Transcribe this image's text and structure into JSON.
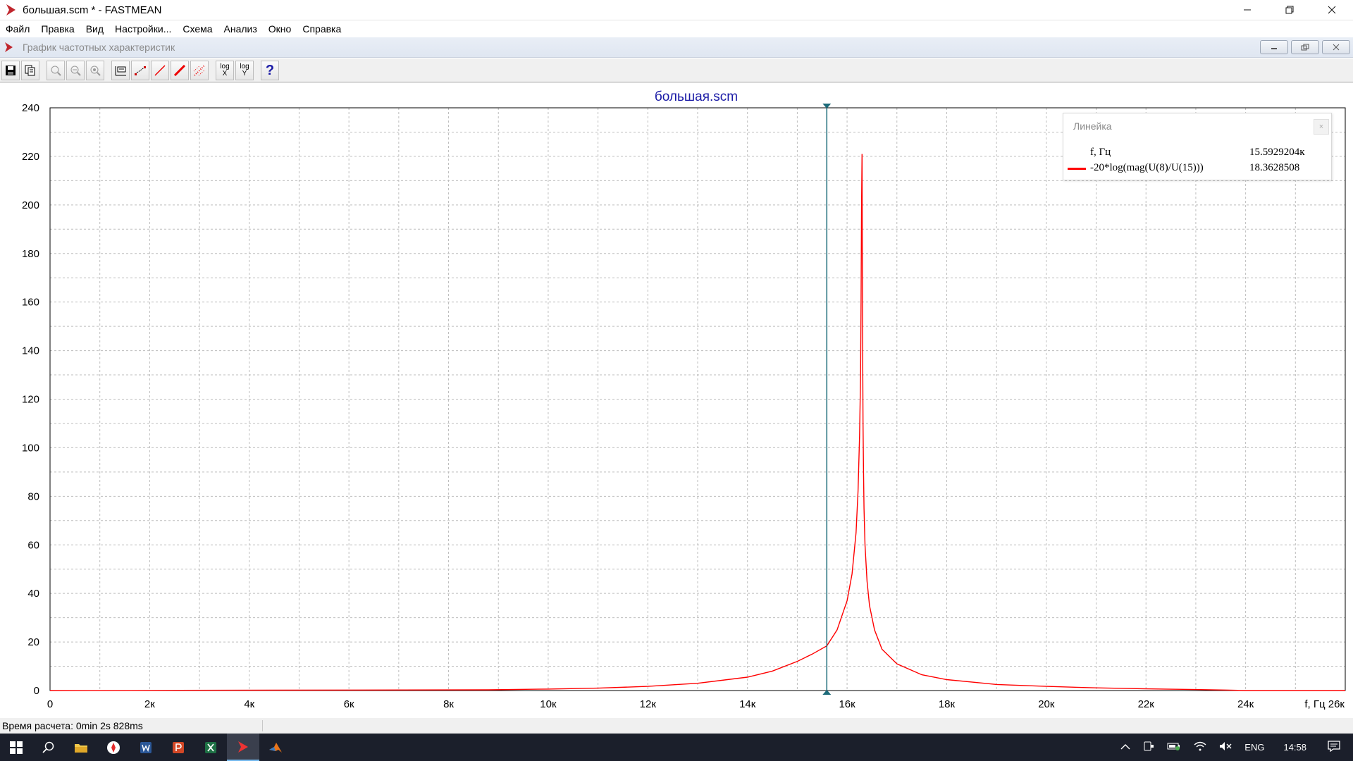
{
  "window": {
    "title": "большая.scm * - FASTMEAN",
    "minimize_icon": "minimize-icon",
    "restore_icon": "restore-icon",
    "close_icon": "close-icon"
  },
  "menu": [
    "Файл",
    "Правка",
    "Вид",
    "Настройки...",
    "Схема",
    "Анализ",
    "Окно",
    "Справка"
  ],
  "child_window": {
    "title": "График частотных характеристик"
  },
  "toolbar": {
    "log_x_top": "log",
    "log_x_bottom": "X",
    "log_y_top": "log",
    "log_y_bottom": "Y",
    "help": "?"
  },
  "ruler_panel": {
    "title": "Линейка",
    "close": "×",
    "rows": [
      {
        "label": "f, Гц",
        "value": "15.5929204к"
      },
      {
        "label": "-20*log(mag(U(8)/U(15)))",
        "value": "18.3628508"
      }
    ]
  },
  "status": {
    "calc_time": "Время расчета: 0min 2s 828ms"
  },
  "taskbar": {
    "lang": "ENG",
    "time": "14:58"
  },
  "colors": {
    "curve": "#ff0000",
    "cursor": "#1c6b7a",
    "grid": "#bdbdbd",
    "title": "#1a1aa6"
  },
  "chart_data": {
    "type": "line",
    "title": "большая.scm",
    "xlabel": "f, Гц",
    "ylabel": "",
    "xlim": [
      0,
      26000
    ],
    "ylim": [
      0,
      240
    ],
    "x_ticks": [
      "0",
      "2к",
      "4к",
      "6к",
      "8к",
      "10к",
      "12к",
      "14к",
      "16к",
      "18к",
      "20к",
      "22к",
      "24к"
    ],
    "x_axis_end_label": "f, Гц 26к",
    "y_ticks": [
      "0",
      "20",
      "40",
      "60",
      "80",
      "100",
      "120",
      "140",
      "160",
      "180",
      "200",
      "220",
      "240"
    ],
    "grid": true,
    "cursor_x": 15592.9204,
    "series": [
      {
        "name": "-20*log(mag(U(8)/U(15)))",
        "color": "#ff0000",
        "x": [
          0,
          8800,
          10000,
          11000,
          12000,
          13000,
          14000,
          14500,
          15000,
          15300,
          15593,
          15800,
          16000,
          16100,
          16180,
          16220,
          16250,
          16270,
          16280,
          16290,
          16300,
          16310,
          16320,
          16330,
          16340,
          16360,
          16400,
          16450,
          16550,
          16700,
          17000,
          17500,
          18000,
          19000,
          20000,
          21000,
          22000,
          23000,
          23600,
          24000,
          26000
        ],
        "y": [
          0,
          0.3,
          0.6,
          1.0,
          1.7,
          3.0,
          5.5,
          8,
          12,
          15,
          18.4,
          25,
          37,
          48,
          65,
          82,
          105,
          130,
          160,
          200,
          221,
          150,
          110,
          90,
          75,
          60,
          45,
          35,
          25,
          17,
          11,
          6.5,
          4.5,
          2.5,
          1.7,
          1.1,
          0.7,
          0.4,
          0.2,
          0,
          0
        ]
      }
    ]
  }
}
